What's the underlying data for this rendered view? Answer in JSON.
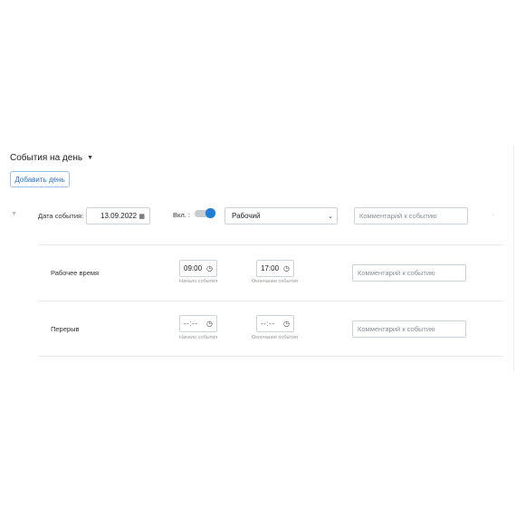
{
  "section": {
    "title": "События на день",
    "caret_icon": "caret-down-icon"
  },
  "add_day_button": "Добавить день",
  "event": {
    "date_label": "Дата события:",
    "date_value": "13.09.2022",
    "enabled_label": "Вкл. :",
    "enabled": true,
    "type_selected": "Рабочий",
    "comment_placeholder": "Комментарий к событию"
  },
  "rows": [
    {
      "label": "Рабочее время",
      "start_value": "09:00",
      "start_hint": "Начало события",
      "end_value": "17:00",
      "end_hint": "Окончание события",
      "comment_placeholder": "Комментарий к событию"
    },
    {
      "label": "Перерыв",
      "start_value": "--:--",
      "start_hint": "Начало события",
      "end_value": "--:--",
      "end_hint": "Окончание события",
      "comment_placeholder": "Комментарий к событию"
    }
  ],
  "colors": {
    "accent": "#1f7fd6",
    "button_text": "#2a74c9",
    "border": "#cdd3da"
  }
}
